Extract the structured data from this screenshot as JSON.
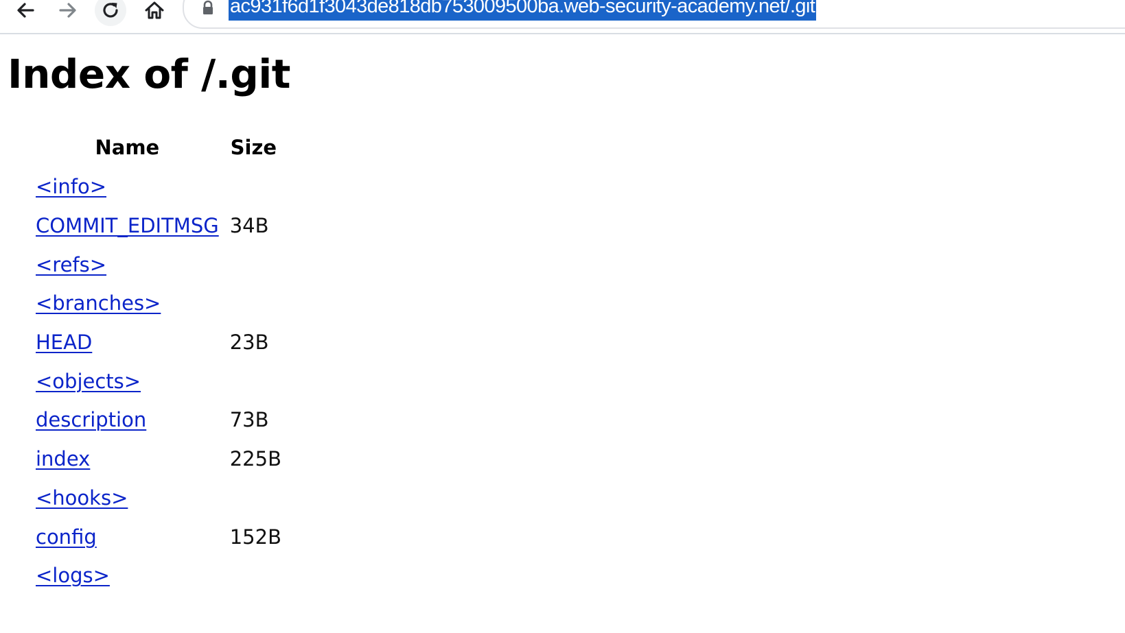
{
  "browser": {
    "url": "ac931f6d1f3043de818db753009500ba.web-security-academy.net/.git",
    "nav_icons": [
      "back-arrow-icon",
      "forward-arrow-icon",
      "reload-icon",
      "home-icon",
      "lock-icon"
    ]
  },
  "page": {
    "title": "Index of /.git",
    "columns": {
      "name": "Name",
      "size": "Size"
    },
    "entries": [
      {
        "name": "<info>",
        "size": ""
      },
      {
        "name": "COMMIT_EDITMSG",
        "size": "34B"
      },
      {
        "name": "<refs>",
        "size": ""
      },
      {
        "name": "<branches>",
        "size": ""
      },
      {
        "name": "HEAD",
        "size": "23B"
      },
      {
        "name": "<objects>",
        "size": ""
      },
      {
        "name": "description",
        "size": "73B"
      },
      {
        "name": "index",
        "size": "225B"
      },
      {
        "name": "<hooks>",
        "size": ""
      },
      {
        "name": "config",
        "size": "152B"
      },
      {
        "name": "<logs>",
        "size": ""
      }
    ]
  },
  "colors": {
    "link": "#0b24c9",
    "url_highlight": "#1a64c9",
    "text": "#111111"
  }
}
